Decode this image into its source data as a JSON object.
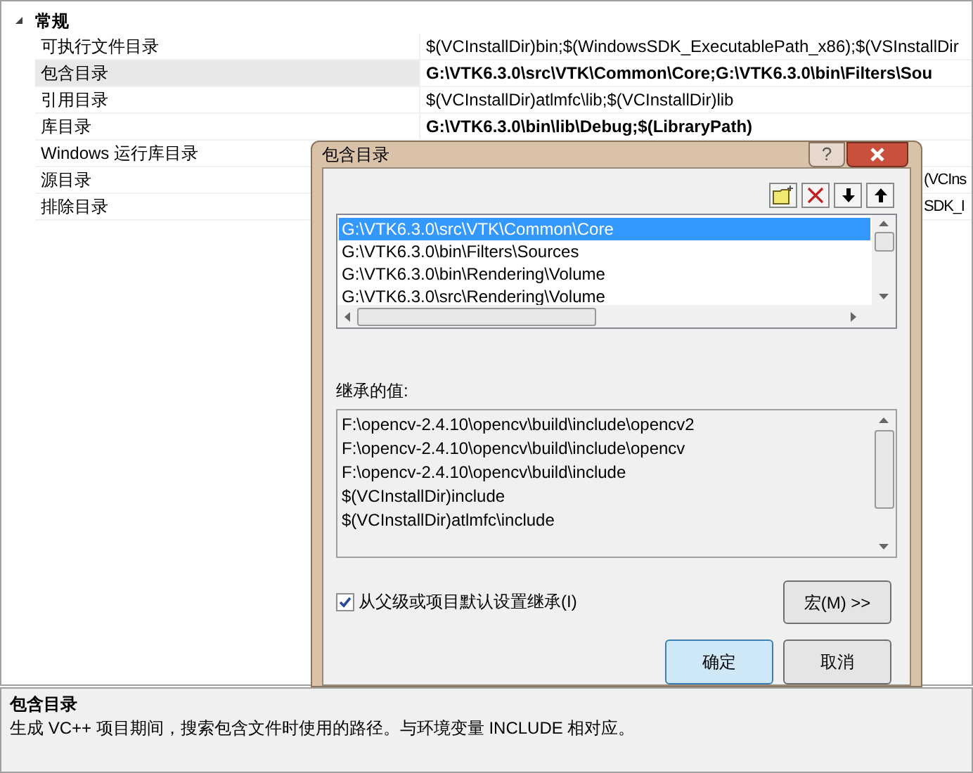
{
  "property_grid": {
    "category": {
      "label": "常规",
      "expanded": true
    },
    "rows": [
      {
        "name": "可执行文件目录",
        "value": "$(VCInstallDir)bin;$(WindowsSDK_ExecutablePath_x86);$(VSInstallDir",
        "bold": false,
        "selected": false,
        "kind": "full"
      },
      {
        "name": "包含目录",
        "value": "G:\\VTK6.3.0\\src\\VTK\\Common\\Core;G:\\VTK6.3.0\\bin\\Filters\\Sou",
        "bold": true,
        "selected": true,
        "kind": "full"
      },
      {
        "name": "引用目录",
        "value": "$(VCInstallDir)atlmfc\\lib;$(VCInstallDir)lib",
        "bold": false,
        "selected": false,
        "kind": "full"
      },
      {
        "name": "库目录",
        "value": "G:\\VTK6.3.0\\bin\\lib\\Debug;$(LibraryPath)",
        "bold": true,
        "selected": false,
        "kind": "full"
      },
      {
        "name": "Windows 运行库目录",
        "selected": false,
        "kind": "hidden"
      },
      {
        "name": "源目录",
        "value": "(VCIns",
        "bold": false,
        "selected": false,
        "kind": "partial"
      },
      {
        "name": "排除目录",
        "value": "SDK_I",
        "bold": false,
        "selected": false,
        "kind": "partial"
      }
    ]
  },
  "description": {
    "title": "包含目录",
    "text": "生成 VC++ 项目期间，搜索包含文件时使用的路径。与环境变量 INCLUDE 相对应。"
  },
  "dialog": {
    "title": "包含目录",
    "help_button": "?",
    "paths": [
      {
        "text": "G:\\VTK6.3.0\\src\\VTK\\Common\\Core",
        "selected": true
      },
      {
        "text": "G:\\VTK6.3.0\\bin\\Filters\\Sources",
        "selected": false
      },
      {
        "text": "G:\\VTK6.3.0\\bin\\Rendering\\Volume",
        "selected": false
      },
      {
        "text": "G:\\VTK6.3.0\\src\\Rendering\\Volume",
        "selected": false
      }
    ],
    "inherited_label": "继承的值:",
    "inherited": [
      "F:\\opencv-2.4.10\\opencv\\build\\include\\opencv2",
      "F:\\opencv-2.4.10\\opencv\\build\\include\\opencv",
      "F:\\opencv-2.4.10\\opencv\\build\\include",
      "$(VCInstallDir)include",
      "$(VCInstallDir)atlmfc\\include"
    ],
    "inherit_checkbox": {
      "label": "从父级或项目默认设置继承(I)",
      "checked": true
    },
    "macro_button": "宏(M) >>",
    "ok_button": "确定",
    "cancel_button": "取消"
  }
}
